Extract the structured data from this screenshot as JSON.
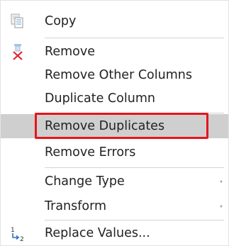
{
  "menu": {
    "items": [
      {
        "id": "copy",
        "label": "Copy",
        "icon": "copy-icon",
        "submenu": false
      },
      {
        "id": "remove",
        "label": "Remove",
        "icon": "remove-column-icon",
        "submenu": false
      },
      {
        "id": "remove-other-columns",
        "label": "Remove Other Columns",
        "icon": null,
        "submenu": false
      },
      {
        "id": "duplicate-column",
        "label": "Duplicate Column",
        "icon": null,
        "submenu": false
      },
      {
        "id": "remove-duplicates",
        "label": "Remove Duplicates",
        "icon": null,
        "submenu": false,
        "highlighted": true
      },
      {
        "id": "remove-errors",
        "label": "Remove Errors",
        "icon": null,
        "submenu": false
      },
      {
        "id": "change-type",
        "label": "Change Type",
        "icon": null,
        "submenu": true
      },
      {
        "id": "transform",
        "label": "Transform",
        "icon": null,
        "submenu": true
      },
      {
        "id": "replace-values",
        "label": "Replace Values...",
        "icon": "replace-values-icon",
        "submenu": false
      }
    ]
  },
  "colors": {
    "highlight": "#cfcfcf",
    "callout": "#e8141c",
    "text": "#222222",
    "separator": "#d4d4d4"
  },
  "icons": {
    "replace_values_from": "1",
    "replace_values_to": "2"
  }
}
